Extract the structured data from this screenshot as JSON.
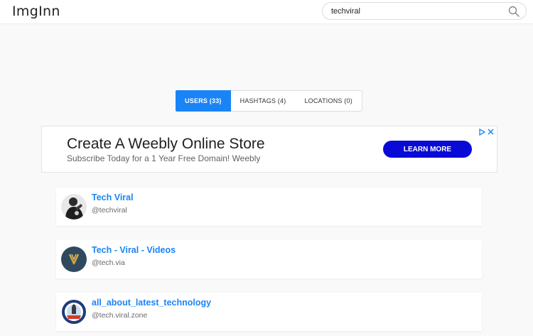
{
  "header": {
    "logo": "ImgInn",
    "search": {
      "value": "techviral"
    }
  },
  "tabs": [
    {
      "label": "USERS (33)",
      "active": true
    },
    {
      "label": "HASHTAGS (4)",
      "active": false
    },
    {
      "label": "LOCATIONS (0)",
      "active": false
    }
  ],
  "ad": {
    "title": "Create A Weebly Online Store",
    "subtitle": "Subscribe Today for a 1 Year Free Domain! Weebly",
    "cta": "LEARN MORE",
    "info_icon": "adchoices-icon",
    "close_icon": "close-icon",
    "cta_color": "#0a0ad6"
  },
  "users": [
    {
      "name": "Tech Viral",
      "handle": "@techviral",
      "avatar": "person-photo"
    },
    {
      "name": "Tech - Viral - Videos",
      "handle": "@tech.via",
      "avatar": "v-logo"
    },
    {
      "name": "all_about_latest_technology",
      "handle": "@tech.viral.zone",
      "avatar": "emblem-logo"
    }
  ],
  "colors": {
    "accent": "#1a84f6",
    "background": "#f9f9f9"
  }
}
